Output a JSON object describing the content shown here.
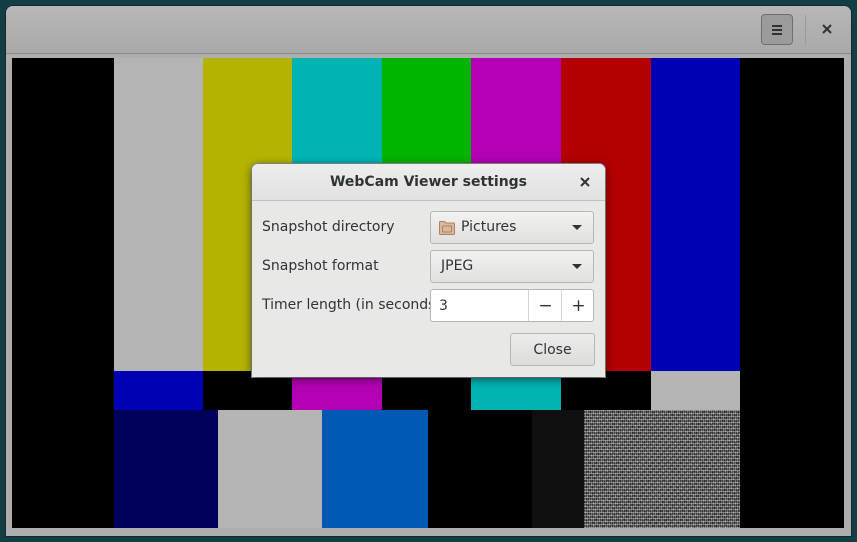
{
  "window": {
    "menu_icon": "hamburger-menu-icon",
    "close_icon": "close-icon"
  },
  "video": {
    "description_colors": {
      "top_bars": [
        "#000000",
        "#b4b4b4",
        "#b4b400",
        "#00b4b4",
        "#00b400",
        "#b400b4",
        "#b40000",
        "#0000b4",
        "#000000"
      ],
      "middle_bars": [
        "#000000",
        "#0000b4",
        "#000000",
        "#b400b4",
        "#000000",
        "#00b4b4",
        "#000000",
        "#b4b4b4",
        "#000000"
      ],
      "bottom_bars": [
        "#000000",
        "#00005a",
        "#b4b4b4",
        "#005ab4",
        "#000000",
        "#0f0f0f",
        "noise",
        "#000000"
      ]
    }
  },
  "dialog": {
    "title": "WebCam Viewer settings",
    "close_icon": "close-icon",
    "snapshot_directory": {
      "label": "Snapshot directory",
      "value": "Pictures",
      "icon": "folder-icon"
    },
    "snapshot_format": {
      "label": "Snapshot format",
      "value": "JPEG"
    },
    "timer_length": {
      "label": "Timer length (in seconds)",
      "value": "3",
      "decrement": "−",
      "increment": "+"
    },
    "close_button": "Close"
  },
  "colors": {
    "accent": "#2e3436",
    "headerbar": "#aeaeae",
    "dialog_bg": "#e8e8e7",
    "desktop": "#123e44"
  }
}
